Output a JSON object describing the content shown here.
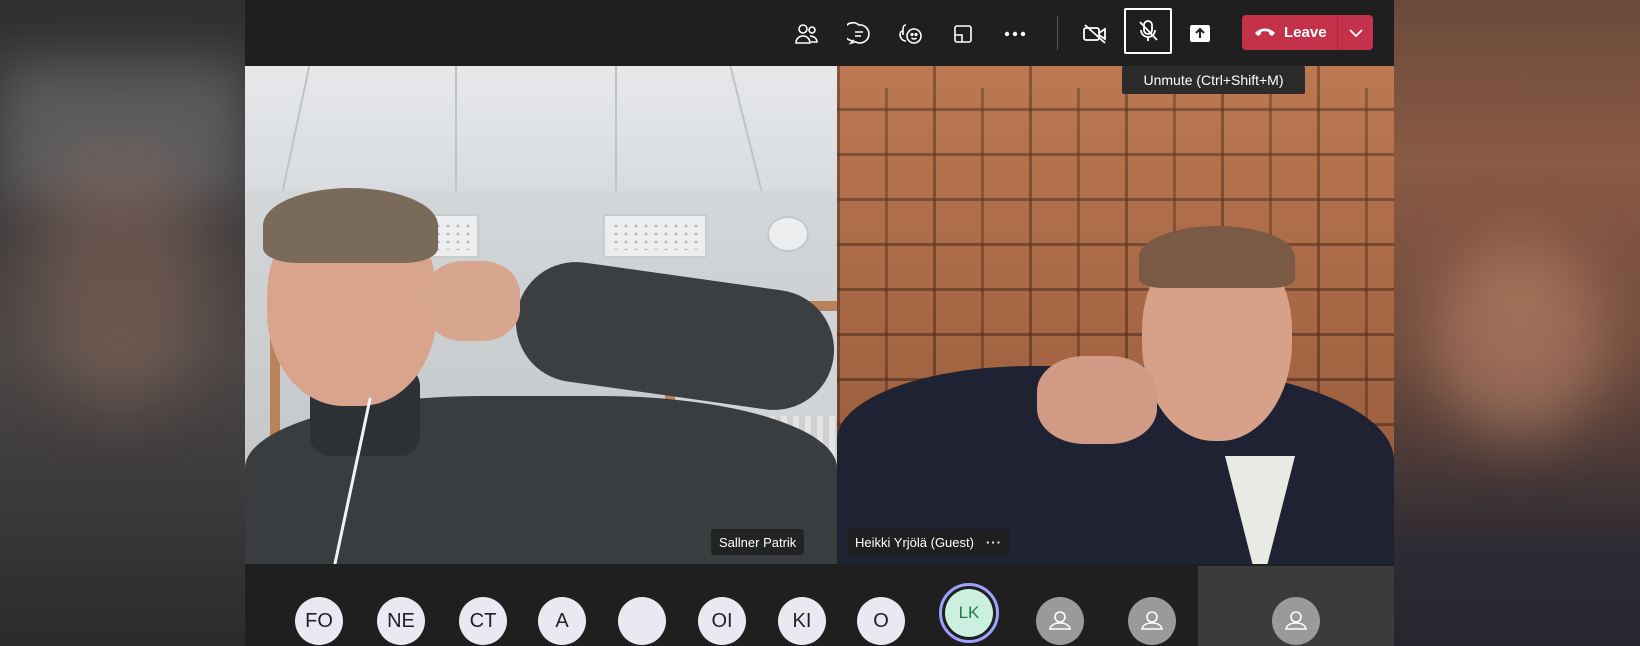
{
  "toolbar": {
    "icons": [
      "people-icon",
      "chat-icon",
      "reactions-icon",
      "rooms-icon",
      "more-icon",
      "camera-off-icon",
      "mic-muted-icon",
      "share-icon"
    ],
    "leave_label": "Leave",
    "tooltip": "Unmute (Ctrl+Shift+M)"
  },
  "videos": [
    {
      "name": "Sallner Patrik"
    },
    {
      "name": "Heikki Yrjölä (Guest)",
      "more": "···"
    }
  ],
  "participants": [
    "FO",
    "NE",
    "CT",
    "A",
    "",
    "OI",
    "KI",
    "O",
    "LK",
    "",
    "",
    ""
  ],
  "colors": {
    "leave": "#c4314b",
    "active_ring": "#9ea2ff",
    "lk_avatar": "#ccf0df",
    "panel": "#1f1f1f"
  }
}
